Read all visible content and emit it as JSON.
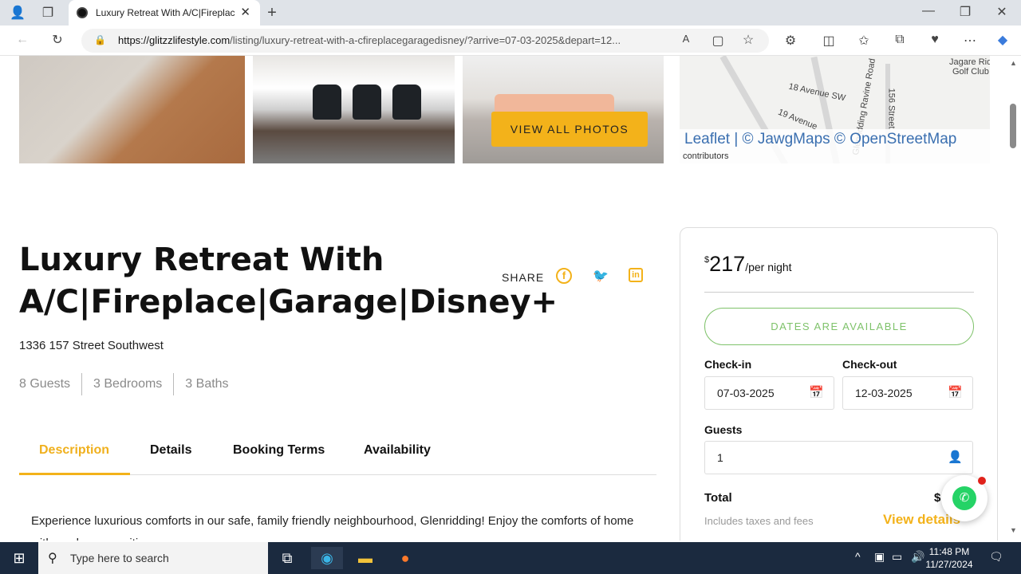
{
  "browser": {
    "tab_title": "Luxury Retreat With A/C|Fireplac",
    "url_domain": "https://glitzzlifestyle.com",
    "url_path": "/listing/luxury-retreat-with-a-cfireplacegaragedisney/?arrive=07-03-2025&depart=12..."
  },
  "gallery": {
    "view_all_label": "VIEW ALL PHOTOS"
  },
  "map": {
    "labels": [
      "18 Avenue SW",
      "19 Avenue",
      "156 Street",
      "Jagare Ridge",
      "Golf Club",
      "Glenridding Ravine Road"
    ],
    "attribution": "Leaflet | © JawgMaps © OpenStreetMap",
    "attribution_line2": "contributors"
  },
  "listing": {
    "title": "Luxury Retreat With A/C|Fireplace|Garage|Disney+",
    "share_label": "SHARE",
    "address": "1336 157 Street Southwest",
    "stats": [
      "8 Guests",
      "3 Bedrooms",
      "3 Baths"
    ],
    "tabs": [
      "Description",
      "Details",
      "Booking Terms",
      "Availability"
    ],
    "description": "Experience luxurious comforts in our safe, family friendly neighbourhood, Glenridding! Enjoy the comforts of home with modern amenities"
  },
  "booking": {
    "currency": "$",
    "price": "217",
    "per": "/per night",
    "availability_label": "DATES ARE AVAILABLE",
    "checkin_label": "Check-in",
    "checkin_value": "07-03-2025",
    "checkout_label": "Check-out",
    "checkout_value": "12-03-2025",
    "guests_label": "Guests",
    "guests_value": "1",
    "total_label": "Total",
    "total_value": "$",
    "taxes_label": "Includes taxes and fees",
    "view_details_label": "View details"
  },
  "taskbar": {
    "search_placeholder": "Type here to search",
    "time": "11:48 PM",
    "date": "11/27/2024"
  },
  "colors": {
    "accent": "#f3b21a",
    "available": "#7ec26a",
    "taskbar": "#1b2a3f"
  }
}
